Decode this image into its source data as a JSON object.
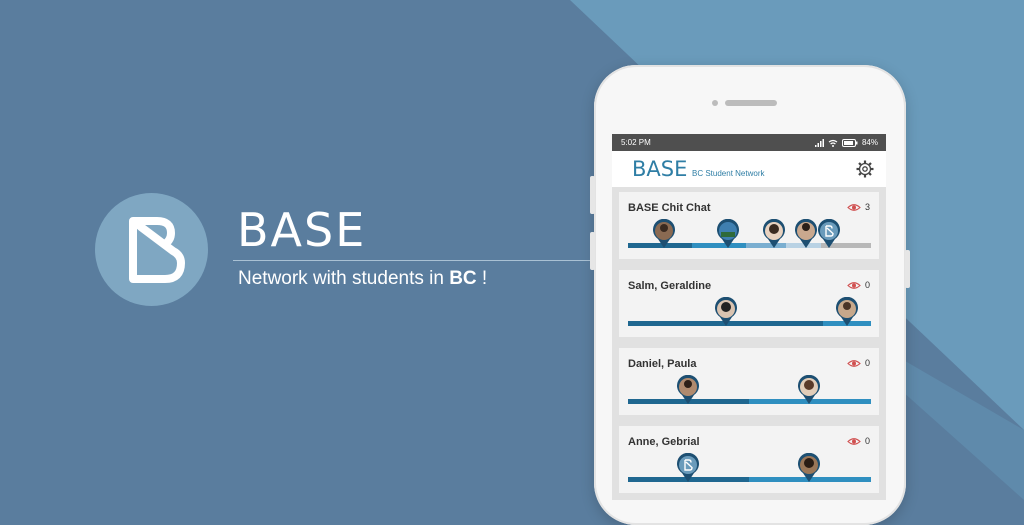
{
  "brand": {
    "name": "BASE",
    "tagline_prefix": "Network with students in ",
    "tagline_bold": "BC",
    "tagline_suffix": " !"
  },
  "status_bar": {
    "time": "5:02 PM",
    "battery": "84%"
  },
  "app_bar": {
    "title": "BASE",
    "subtitle": "BC Student Network",
    "settings_icon": "gear-icon"
  },
  "chats": [
    {
      "title": "BASE Chit Chat",
      "views": "3",
      "avatar_count": 5
    },
    {
      "title": "Salm, Geraldine",
      "views": "0",
      "avatar_count": 2
    },
    {
      "title": "Daniel, Paula",
      "views": "0",
      "avatar_count": 2
    },
    {
      "title": "Anne, Gebrial",
      "views": "0",
      "avatar_count": 2
    }
  ],
  "colors": {
    "bg_dark": "#5a7d9e",
    "bg_light": "#6a9bbb",
    "accent": "#2f7ea5",
    "bar_dark": "#1f6790",
    "bar_light": "#2f8fc0"
  }
}
